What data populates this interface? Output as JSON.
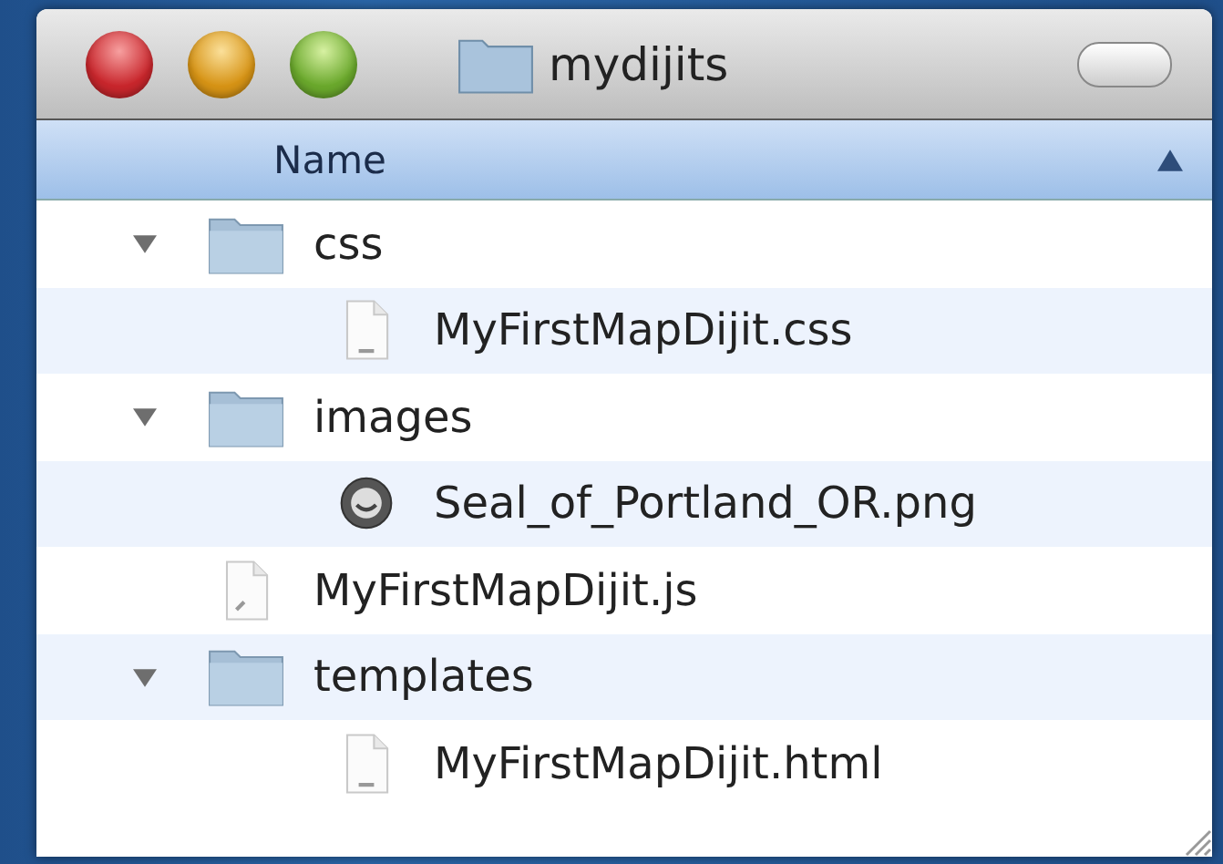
{
  "window": {
    "title": "mydijits"
  },
  "column_header": {
    "label": "Name",
    "sorted_ascending": true
  },
  "items": [
    {
      "kind": "folder",
      "name": "css",
      "expanded": true,
      "children": [
        {
          "kind": "file",
          "name": "MyFirstMapDijit.css"
        }
      ]
    },
    {
      "kind": "folder",
      "name": "images",
      "expanded": true,
      "children": [
        {
          "kind": "image",
          "name": "Seal_of_Portland_OR.png"
        }
      ]
    },
    {
      "kind": "script",
      "name": "MyFirstMapDijit.js"
    },
    {
      "kind": "folder",
      "name": "templates",
      "expanded": true,
      "children": [
        {
          "kind": "file",
          "name": "MyFirstMapDijit.html"
        }
      ]
    }
  ]
}
